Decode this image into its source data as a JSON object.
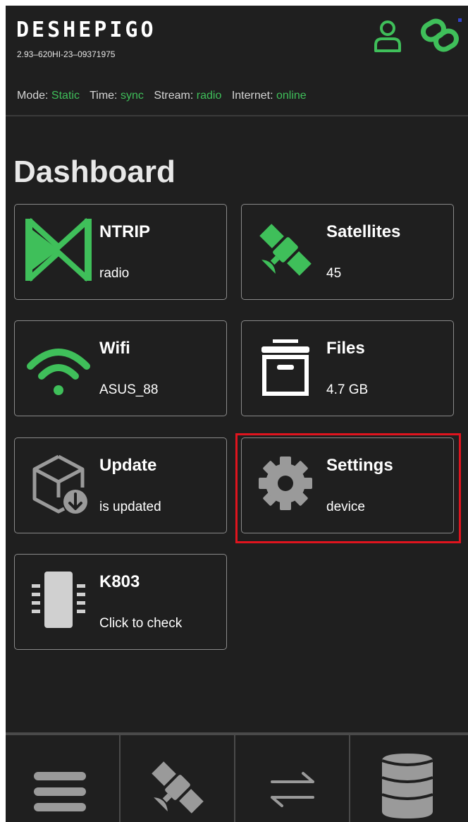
{
  "header": {
    "brand": "DESHEPIGO",
    "serial": "2.93–620HI-23–09371975",
    "user_icon": "user-icon",
    "link_icon": "link-icon"
  },
  "status_bar": {
    "mode_label": "Mode:",
    "mode_value": "Static",
    "time_label": "Time:",
    "time_value": "sync",
    "stream_label": "Stream:",
    "stream_value": "radio",
    "internet_label": "Internet:",
    "internet_value": "online"
  },
  "page_title": "Dashboard",
  "cards": [
    {
      "id": "ntrip",
      "name": "NTRIP",
      "value": "radio",
      "icon": "ntrip-icon"
    },
    {
      "id": "satellites",
      "name": "Satellites",
      "value": "45",
      "icon": "satellite-icon"
    },
    {
      "id": "wifi",
      "name": "Wifi",
      "value": "ASUS_88",
      "icon": "wifi-icon"
    },
    {
      "id": "files",
      "name": "Files",
      "value": "4.7 GB",
      "icon": "archive-icon"
    },
    {
      "id": "update",
      "name": "Update",
      "value": "is updated",
      "icon": "update-package-icon"
    },
    {
      "id": "settings",
      "name": "Settings",
      "value": "device",
      "icon": "gear-icon"
    },
    {
      "id": "k803",
      "name": "K803",
      "value": "Click to check",
      "icon": "chip-icon"
    }
  ],
  "bottom_nav": [
    {
      "id": "menu",
      "icon": "menu-icon"
    },
    {
      "id": "satellites",
      "icon": "satellite-icon"
    },
    {
      "id": "transfer",
      "icon": "transfer-arrows-icon"
    },
    {
      "id": "database",
      "icon": "database-icon"
    }
  ],
  "colors": {
    "background": "#1f1f1f",
    "accent_green": "#3fbf5a",
    "text": "#ffffff",
    "icon_gray": "#9a9a9a",
    "highlight_red": "#e0141e",
    "card_border": "#8a8a8a"
  }
}
